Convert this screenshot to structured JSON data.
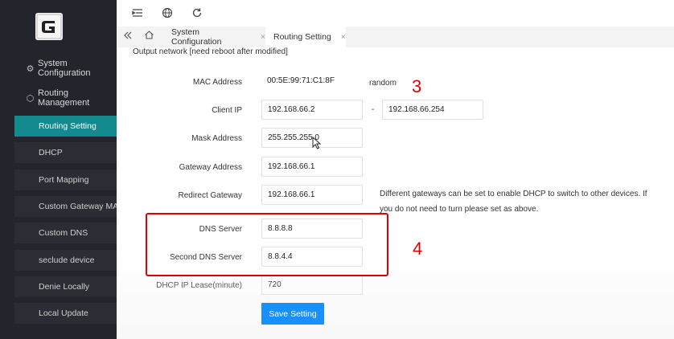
{
  "sidebar": {
    "groups": [
      {
        "label": "System Configuration",
        "icon": "gear-icon"
      },
      {
        "label": "Routing Management",
        "icon": "cube-icon"
      }
    ],
    "items": [
      {
        "label": "Routing Setting",
        "active": true
      },
      {
        "label": "DHCP"
      },
      {
        "label": "Port Mapping"
      },
      {
        "label": "Custom Gateway MAC"
      },
      {
        "label": "Custom DNS"
      },
      {
        "label": "seclude device"
      },
      {
        "label": "Denie Locally"
      },
      {
        "label": "Local Update"
      }
    ]
  },
  "topbar": {
    "icons": [
      "menu-fold-icon",
      "globe-icon",
      "refresh-icon"
    ]
  },
  "tabs": [
    {
      "label": "System Configuration",
      "close": "×"
    },
    {
      "label": "Routing Setting",
      "close": "×",
      "active": true
    }
  ],
  "form": {
    "section_title": "Output network  [need reboot after modified]",
    "mac_label": "MAC Address",
    "mac_value": "00:5E:99:71:C1:8F",
    "mac_note": "random",
    "client_ip_label": "Client IP",
    "client_ip_start": "192.168.66.2",
    "client_ip_sep": "-",
    "client_ip_end": "192.168.66.254",
    "mask_label": "Mask Address",
    "mask_value": "255.255.255.0",
    "gateway_label": "Gateway Address",
    "gateway_value": "192.168.66.1",
    "redirect_label": "Redirect Gateway",
    "redirect_value": "192.168.66.1",
    "redirect_hint": "Different gateways can be set to enable DHCP to switch to other devices. If you do not need to turn please set as above.",
    "dns_label": "DNS Server",
    "dns_value": "8.8.8.8",
    "dns2_label": "Second DNS Server",
    "dns2_value": "8.8.4.4",
    "lease_label": "DHCP IP Lease(minute)",
    "lease_value": "720",
    "save_label": "Save Setting"
  },
  "annotations": {
    "step3": "3",
    "step4": "4",
    "color": "#e00000"
  }
}
